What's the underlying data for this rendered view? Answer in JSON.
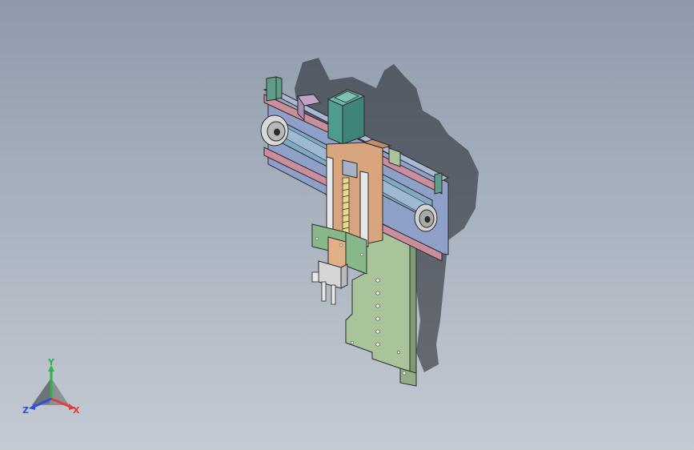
{
  "viewport": {
    "background_top": "#8e9aab",
    "background_bottom": "#c4cad2"
  },
  "model": {
    "colors": {
      "rail_pink": "#c98d9c",
      "belt_blue": "#8fa6c8",
      "plate_green": "#a9c49a",
      "motor_teal": "#4f9c8e",
      "block_green": "#86b88a",
      "carriage_orange": "#d9a57f",
      "shadow": "#1e2026"
    }
  },
  "triad": {
    "x_label": "X",
    "y_label": "Y",
    "z_label": "Z",
    "x_color": "#e03c3c",
    "y_color": "#2fb34a",
    "z_color": "#2f4fd8"
  }
}
